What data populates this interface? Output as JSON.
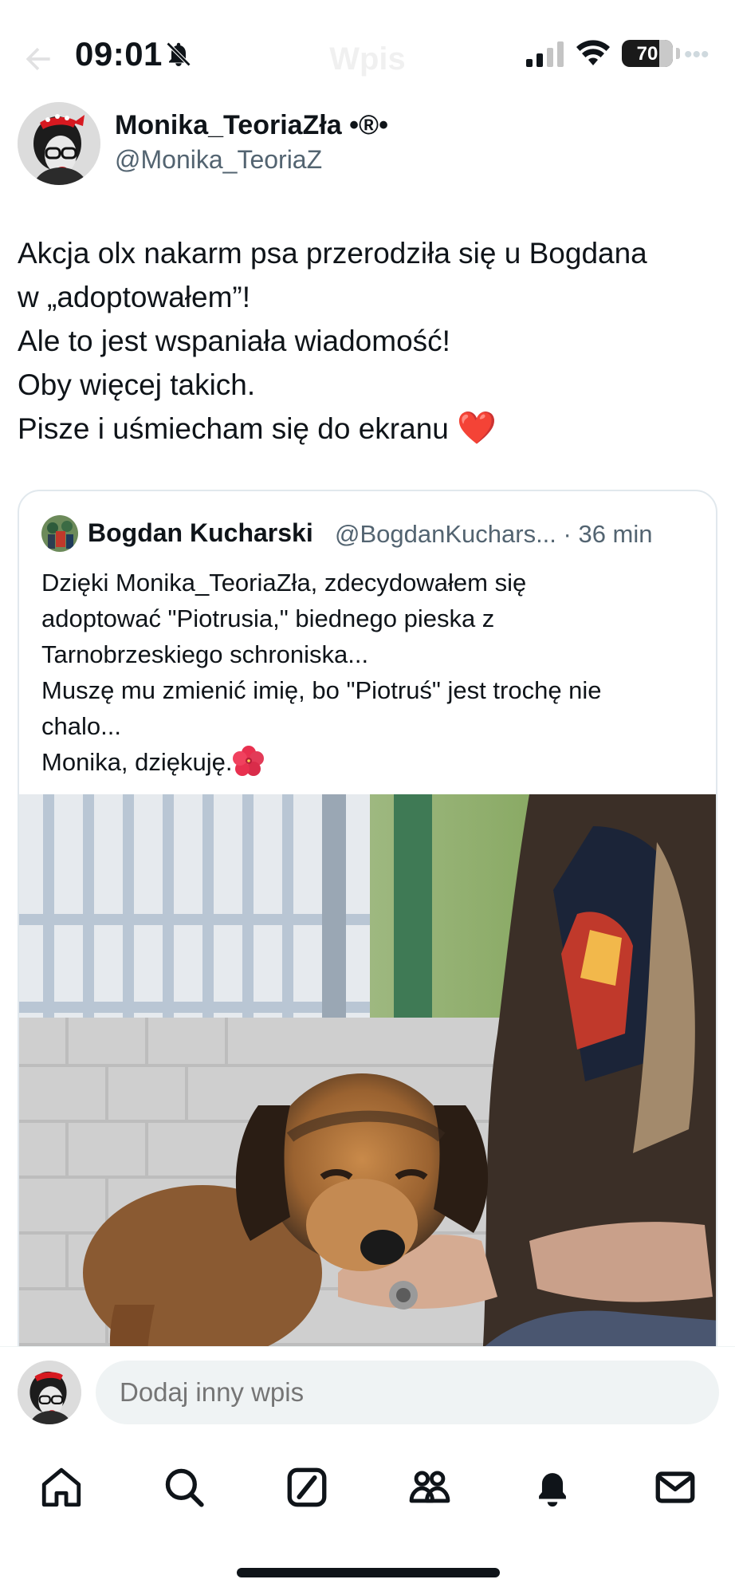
{
  "status": {
    "time": "09:01",
    "battery": "70"
  },
  "header": {
    "title": "Wpis"
  },
  "post": {
    "author_name": "Monika_TeoriaZła •®•",
    "author_handle": "@Monika_TeoriaZ",
    "lines": [
      "Akcja olx nakarm psa przerodziła się u Bogdana",
      "w „adoptowałem”!",
      "Ale to jest wspaniała wiadomość!",
      "Oby więcej takich.",
      "Pisze i uśmiecham się do ekranu"
    ],
    "heart": "❤️"
  },
  "quote": {
    "author_name": "Bogdan Kucharski",
    "meta": "@BogdanKuchars... · 36 min",
    "lines": [
      "Dzięki Monika_TeoriaZła, zdecydowałem się",
      "adoptować \"Piotrusia,\" biednego pieska z",
      "Tarnobrzeskiego schroniska...",
      "Muszę mu zmienić imię, bo \"Piotruś\" jest trochę nie",
      "chalo...",
      "Monika, dziękuję."
    ]
  },
  "reply": {
    "placeholder": "Dodaj inny wpis"
  },
  "icons": {
    "status": [
      "bell-off-icon",
      "signal-icon",
      "wifi-icon",
      "battery-icon"
    ],
    "tabs": [
      "home-icon",
      "search-icon",
      "grok-icon",
      "communities-icon",
      "notifications-icon",
      "messages-icon"
    ]
  },
  "colors": {
    "text": "#0f1419",
    "secondary": "#536471",
    "heart": "#d0021b",
    "input_bg": "#eff3f4",
    "border": "#e1e8ed"
  }
}
